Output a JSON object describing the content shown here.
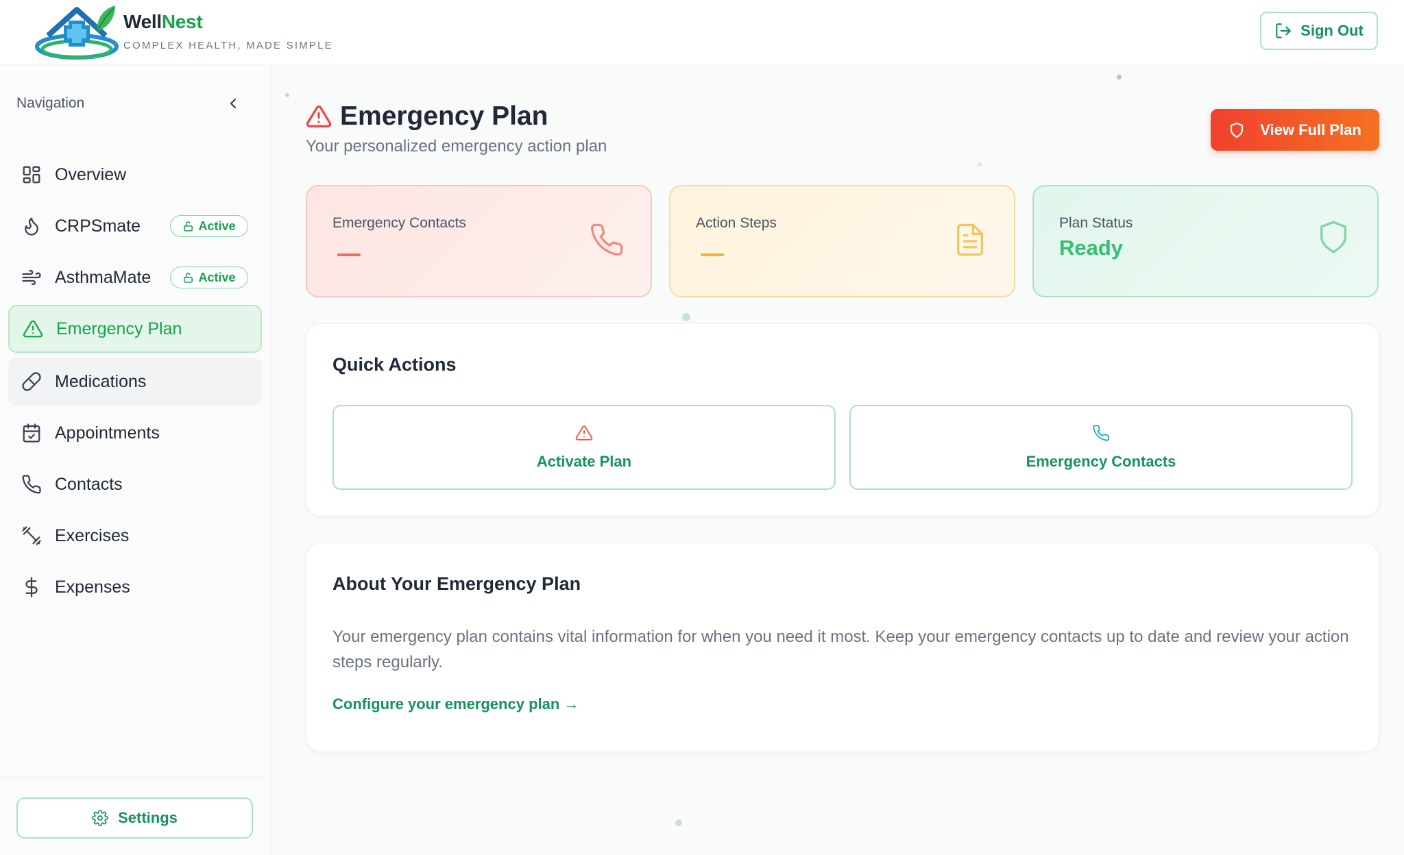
{
  "header": {
    "brand_part1": "Well",
    "brand_part2": "Nest",
    "tagline": "COMPLEX HEALTH, MADE SIMPLE",
    "sign_out_label": "Sign Out",
    "sign_out_icon": "log-out-icon",
    "logo_icon": "house-with-medical-cross-logo"
  },
  "sidebar": {
    "heading": "Navigation",
    "collapse_icon": "chevron-left-icon",
    "items": [
      {
        "label": "Overview",
        "icon": "grid-icon",
        "active": false
      },
      {
        "label": "CRPSmate",
        "icon": "flame-icon",
        "badge": "Active",
        "active": false
      },
      {
        "label": "AsthmaMate",
        "icon": "wind-icon",
        "badge": "Active",
        "active": false
      },
      {
        "label": "Emergency Plan",
        "icon": "alert-triangle-icon",
        "active": true
      },
      {
        "label": "Medications",
        "icon": "pill-icon",
        "active": false
      },
      {
        "label": "Appointments",
        "icon": "calendar-check-icon",
        "active": false
      },
      {
        "label": "Contacts",
        "icon": "phone-icon",
        "active": false
      },
      {
        "label": "Exercises",
        "icon": "dumbbell-icon",
        "active": false
      },
      {
        "label": "Expenses",
        "icon": "dollar-icon",
        "active": false
      }
    ],
    "settings_label": "Settings"
  },
  "main": {
    "title": "Emergency Plan",
    "subtitle": "Your personalized emergency action plan",
    "view_full_plan_label": "View Full Plan",
    "stats": [
      {
        "label": "Emergency Contacts",
        "value": "—",
        "icon": "phone-icon",
        "color": "#ef6b5b"
      },
      {
        "label": "Action Steps",
        "value": "—",
        "icon": "file-text-icon",
        "color": "#f5b130"
      },
      {
        "label": "Plan Status",
        "value": "Ready",
        "icon": "shield-icon",
        "color": "#35bf73"
      }
    ],
    "quick_actions": {
      "title": "Quick Actions",
      "buttons": [
        {
          "label": "Activate Plan",
          "icon": "alert-triangle-icon"
        },
        {
          "label": "Emergency Contacts",
          "icon": "phone-icon"
        }
      ]
    },
    "about": {
      "title": "About Your Emergency Plan",
      "text": "Your emergency plan contains vital information for when you need it most. Keep your emergency contacts up to date and review your action steps regularly.",
      "link_label": "Configure your emergency plan →"
    }
  },
  "colors": {
    "accent_green": "#16a34a",
    "danger_start": "#f0412e",
    "danger_end": "#f57122"
  }
}
